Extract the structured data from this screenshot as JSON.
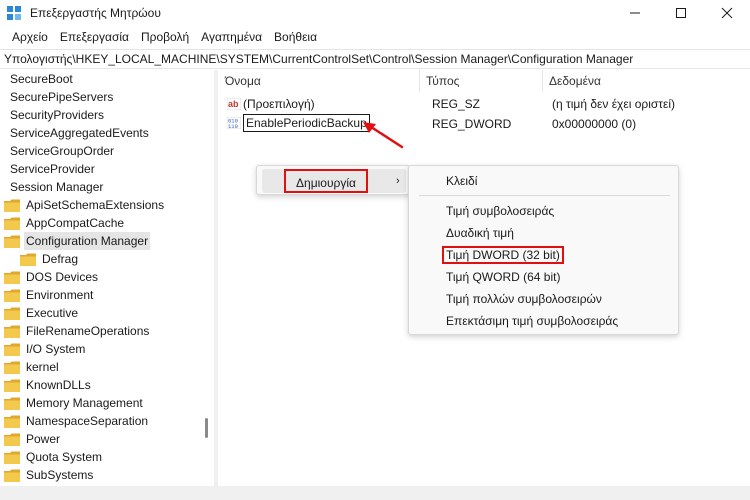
{
  "window": {
    "title": "Επεξεργαστής Μητρώου",
    "minimize_icon": "minimize-icon",
    "maximize_icon": "maximize-icon",
    "close_icon": "close-icon"
  },
  "menubar": {
    "items": [
      "Αρχείο",
      "Επεξεργασία",
      "Προβολή",
      "Αγαπημένα",
      "Βοήθεια"
    ]
  },
  "address": {
    "path": "Υπολογιστής\\HKEY_LOCAL_MACHINE\\SYSTEM\\CurrentControlSet\\Control\\Session Manager\\Configuration Manager"
  },
  "tree": {
    "items": [
      {
        "label": "SecureBoot",
        "folder": false,
        "selected": false
      },
      {
        "label": "SecurePipeServers",
        "folder": false,
        "selected": false
      },
      {
        "label": "SecurityProviders",
        "folder": false,
        "selected": false
      },
      {
        "label": "ServiceAggregatedEvents",
        "folder": false,
        "selected": false
      },
      {
        "label": "ServiceGroupOrder",
        "folder": false,
        "selected": false
      },
      {
        "label": "ServiceProvider",
        "folder": false,
        "selected": false
      },
      {
        "label": "Session Manager",
        "folder": false,
        "selected": false
      },
      {
        "label": "ApiSetSchemaExtensions",
        "folder": true,
        "selected": false
      },
      {
        "label": "AppCompatCache",
        "folder": true,
        "selected": false
      },
      {
        "label": "Configuration Manager",
        "folder": true,
        "selected": true
      },
      {
        "label": "Defrag",
        "folder": true,
        "selected": false
      },
      {
        "label": "DOS Devices",
        "folder": true,
        "selected": false
      },
      {
        "label": "Environment",
        "folder": true,
        "selected": false
      },
      {
        "label": "Executive",
        "folder": true,
        "selected": false
      },
      {
        "label": "FileRenameOperations",
        "folder": true,
        "selected": false
      },
      {
        "label": "I/O System",
        "folder": true,
        "selected": false
      },
      {
        "label": "kernel",
        "folder": true,
        "selected": false
      },
      {
        "label": "KnownDLLs",
        "folder": true,
        "selected": false
      },
      {
        "label": "Memory Management",
        "folder": true,
        "selected": false
      },
      {
        "label": "NamespaceSeparation",
        "folder": true,
        "selected": false
      },
      {
        "label": "Power",
        "folder": true,
        "selected": false
      },
      {
        "label": "Quota System",
        "folder": true,
        "selected": false
      },
      {
        "label": "SubSystems",
        "folder": true,
        "selected": false
      }
    ]
  },
  "values": {
    "columns": {
      "name": "Όνομα",
      "type": "Τύπος",
      "data": "Δεδομένα"
    },
    "rows": [
      {
        "name": "(Προεπιλογή)",
        "type": "REG_SZ",
        "data": "(η τιμή δεν έχει οριστεί)",
        "icon": "string-value-icon"
      },
      {
        "name": "EnablePeriodicBackup",
        "type": "REG_DWORD",
        "data": "0x00000000 (0)",
        "icon": "binary-value-icon"
      }
    ]
  },
  "context_menu": {
    "new_label": "Δημιουργία",
    "submenu": {
      "key": "Κλειδί",
      "string_value": "Τιμή συμβολοσειράς",
      "binary_value": "Δυαδική τιμή",
      "dword_value": "Τιμή DWORD (32 bit)",
      "qword_value": "Τιμή QWORD (64 bit)",
      "multi_string_value": "Τιμή πολλών συμβολοσειρών",
      "expandable_string_value": "Επεκτάσιμη τιμή συμβολοσειράς"
    }
  },
  "colors": {
    "highlight_border": "#e01010",
    "folder": "#f2c94c",
    "selection": "#e5e5e5"
  }
}
